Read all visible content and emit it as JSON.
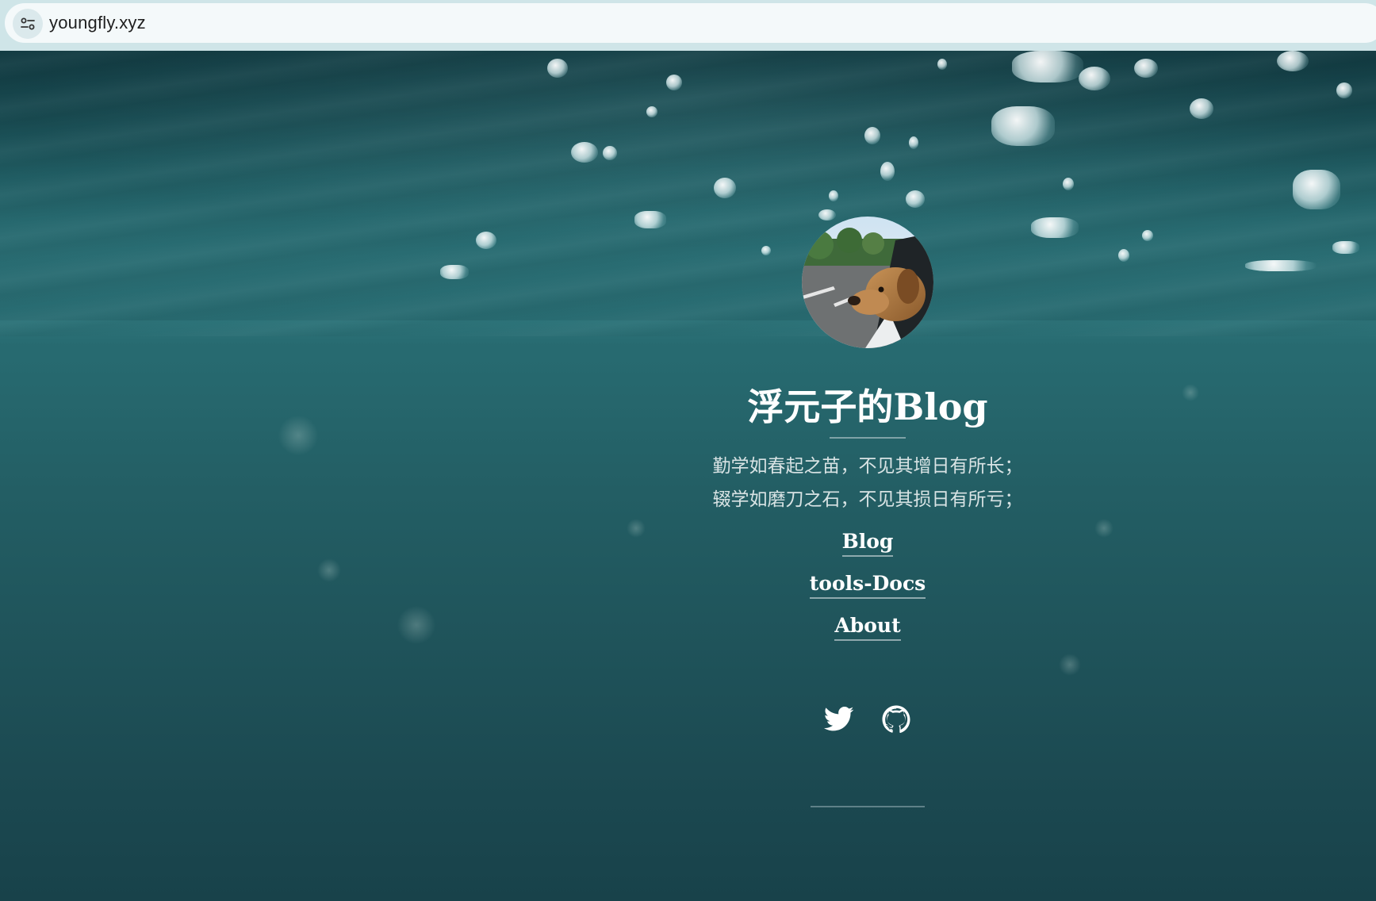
{
  "browser": {
    "url": "youngfly.xyz",
    "site_info_icon": "tune-icon"
  },
  "hero": {
    "title": "浮元子的Blog",
    "motto_line1": "勤学如春起之苗，不见其增日有所长；",
    "motto_line2": "辍学如磨刀之石，不见其损日有所亏；",
    "avatar_icon": "dog-avatar"
  },
  "nav": [
    {
      "label": "Blog"
    },
    {
      "label": "tools-Docs"
    },
    {
      "label": "About"
    }
  ],
  "social": [
    {
      "icon": "twitter-icon"
    },
    {
      "icon": "github-icon"
    }
  ],
  "colors": {
    "water_top": "#1b4b52",
    "water_mid": "#2a6e74",
    "water_bottom": "#18424a",
    "text": "#ffffff",
    "motto": "#d8e3e4",
    "browser_bar": "#cfe5e8"
  }
}
